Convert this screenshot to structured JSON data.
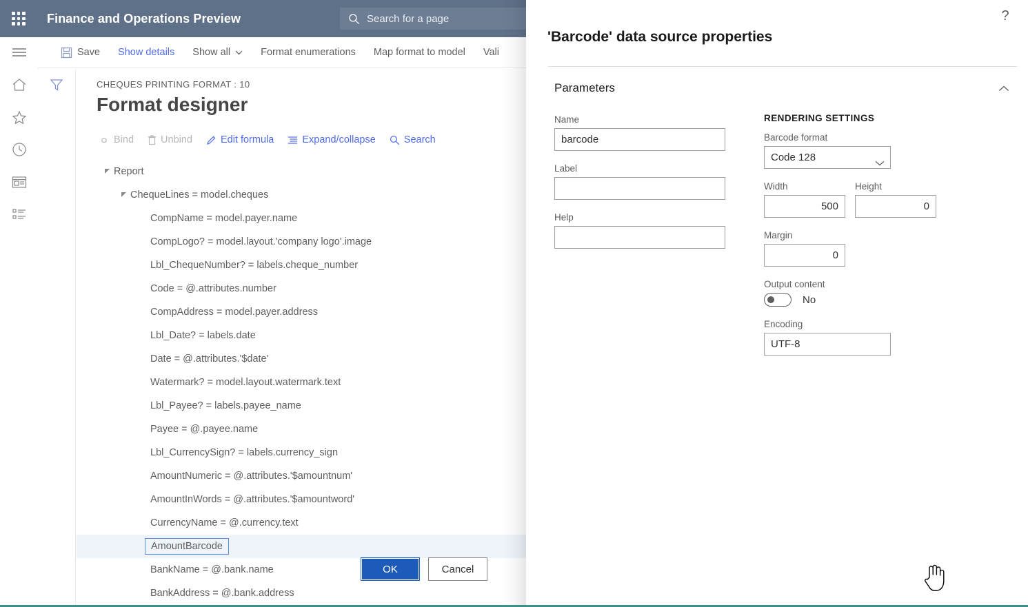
{
  "topnav": {
    "waffle_icon": "waffle-grid-icon",
    "app_title": "Finance and Operations Preview",
    "search": {
      "icon": "search-icon",
      "placeholder": "Search for a page",
      "value": ""
    }
  },
  "rail": {
    "items": [
      {
        "icon": "hamburger-menu-icon",
        "name": "navigation-menu"
      },
      {
        "icon": "home-icon",
        "name": "home"
      },
      {
        "icon": "star-icon",
        "name": "favorites"
      },
      {
        "icon": "clock-icon",
        "name": "recent"
      },
      {
        "icon": "workspace-icon",
        "name": "workspaces"
      },
      {
        "icon": "list-icon",
        "name": "modules"
      }
    ]
  },
  "commandbar": {
    "items": [
      {
        "label": "Save",
        "icon": "save-icon",
        "style": "plain",
        "caret": false
      },
      {
        "label": "Show details",
        "icon": "",
        "style": "link",
        "caret": false
      },
      {
        "label": "Show all",
        "icon": "",
        "style": "plain",
        "caret": true
      },
      {
        "label": "Format enumerations",
        "icon": "",
        "style": "plain",
        "caret": false
      },
      {
        "label": "Map format to model",
        "icon": "",
        "style": "plain",
        "caret": false
      },
      {
        "label": "Vali",
        "icon": "",
        "style": "plain",
        "caret": false
      }
    ]
  },
  "filterstrip": {
    "icon": "filter-funnel-icon"
  },
  "page": {
    "breadcrumb": "CHEQUES PRINTING FORMAT : 10",
    "title": "Format designer",
    "subtoolbar": [
      {
        "label": "Bind",
        "icon": "bind-link-icon",
        "disabled": true
      },
      {
        "label": "Unbind",
        "icon": "unbind-trash-icon",
        "disabled": true
      },
      {
        "label": "Edit formula",
        "icon": "pencil-icon",
        "disabled": false
      },
      {
        "label": "Expand/collapse",
        "icon": "expand-collapse-icon",
        "disabled": false
      },
      {
        "label": "Search",
        "icon": "search-icon",
        "disabled": false
      }
    ],
    "tree": [
      {
        "label": "Report",
        "level": 0,
        "twisty": "expanded",
        "selected": false
      },
      {
        "label": "ChequeLines = model.cheques",
        "level": 1,
        "twisty": "expanded",
        "selected": false
      },
      {
        "label": "CompName = model.payer.name",
        "level": 2,
        "twisty": "none",
        "selected": false
      },
      {
        "label": "CompLogo? = model.layout.'company logo'.image",
        "level": 2,
        "twisty": "none",
        "selected": false
      },
      {
        "label": "Lbl_ChequeNumber? = labels.cheque_number",
        "level": 2,
        "twisty": "none",
        "selected": false
      },
      {
        "label": "Code = @.attributes.number",
        "level": 2,
        "twisty": "none",
        "selected": false
      },
      {
        "label": "CompAddress = model.payer.address",
        "level": 2,
        "twisty": "none",
        "selected": false
      },
      {
        "label": "Lbl_Date? = labels.date",
        "level": 2,
        "twisty": "none",
        "selected": false
      },
      {
        "label": "Date = @.attributes.'$date'",
        "level": 2,
        "twisty": "none",
        "selected": false
      },
      {
        "label": "Watermark? = model.layout.watermark.text",
        "level": 2,
        "twisty": "none",
        "selected": false
      },
      {
        "label": "Lbl_Payee? = labels.payee_name",
        "level": 2,
        "twisty": "none",
        "selected": false
      },
      {
        "label": "Payee = @.payee.name",
        "level": 2,
        "twisty": "none",
        "selected": false
      },
      {
        "label": "Lbl_CurrencySign? = labels.currency_sign",
        "level": 2,
        "twisty": "none",
        "selected": false
      },
      {
        "label": "AmountNumeric = @.attributes.'$amountnum'",
        "level": 2,
        "twisty": "none",
        "selected": false
      },
      {
        "label": "AmountInWords = @.attributes.'$amountword'",
        "level": 2,
        "twisty": "none",
        "selected": false
      },
      {
        "label": "CurrencyName = @.currency.text",
        "level": 2,
        "twisty": "none",
        "selected": false
      },
      {
        "label": "AmountBarcode",
        "level": 2,
        "twisty": "none",
        "selected": true
      },
      {
        "label": "BankName = @.bank.name",
        "level": 2,
        "twisty": "none",
        "selected": false
      },
      {
        "label": "BankAddress = @.bank.address",
        "level": 2,
        "twisty": "none",
        "selected": false
      }
    ]
  },
  "panel": {
    "help_icon": "question-mark-icon",
    "title": "'Barcode' data source properties",
    "section": {
      "title": "Parameters",
      "collapse_icon": "chevron-up-icon",
      "expanded": true
    },
    "fields": {
      "name_label": "Name",
      "name_value": "barcode",
      "label_label": "Label",
      "label_value": "",
      "help_label": "Help",
      "help_value": ""
    },
    "rendering": {
      "group_title": "RENDERING SETTINGS",
      "barcode_format_label": "Barcode format",
      "barcode_format_value": "Code 128",
      "barcode_format_options": [
        "Code 128"
      ],
      "width_label": "Width",
      "width_value": "500",
      "height_label": "Height",
      "height_value": "0",
      "margin_label": "Margin",
      "margin_value": "0",
      "output_content_label": "Output content",
      "output_content_value": "No",
      "output_content_on": false,
      "encoding_label": "Encoding",
      "encoding_value": "UTF-8"
    },
    "footer": {
      "ok_label": "OK",
      "cancel_label": "Cancel"
    }
  },
  "colors": {
    "nav_background": "#5f7089",
    "nav_search_background": "#6d7d94",
    "accent_link": "#4f6bed",
    "primary_button": "#1c5bba",
    "selection_row": "#eff4fb",
    "selection_border": "#5b8de0",
    "bottom_rule": "#3d8f8a"
  }
}
